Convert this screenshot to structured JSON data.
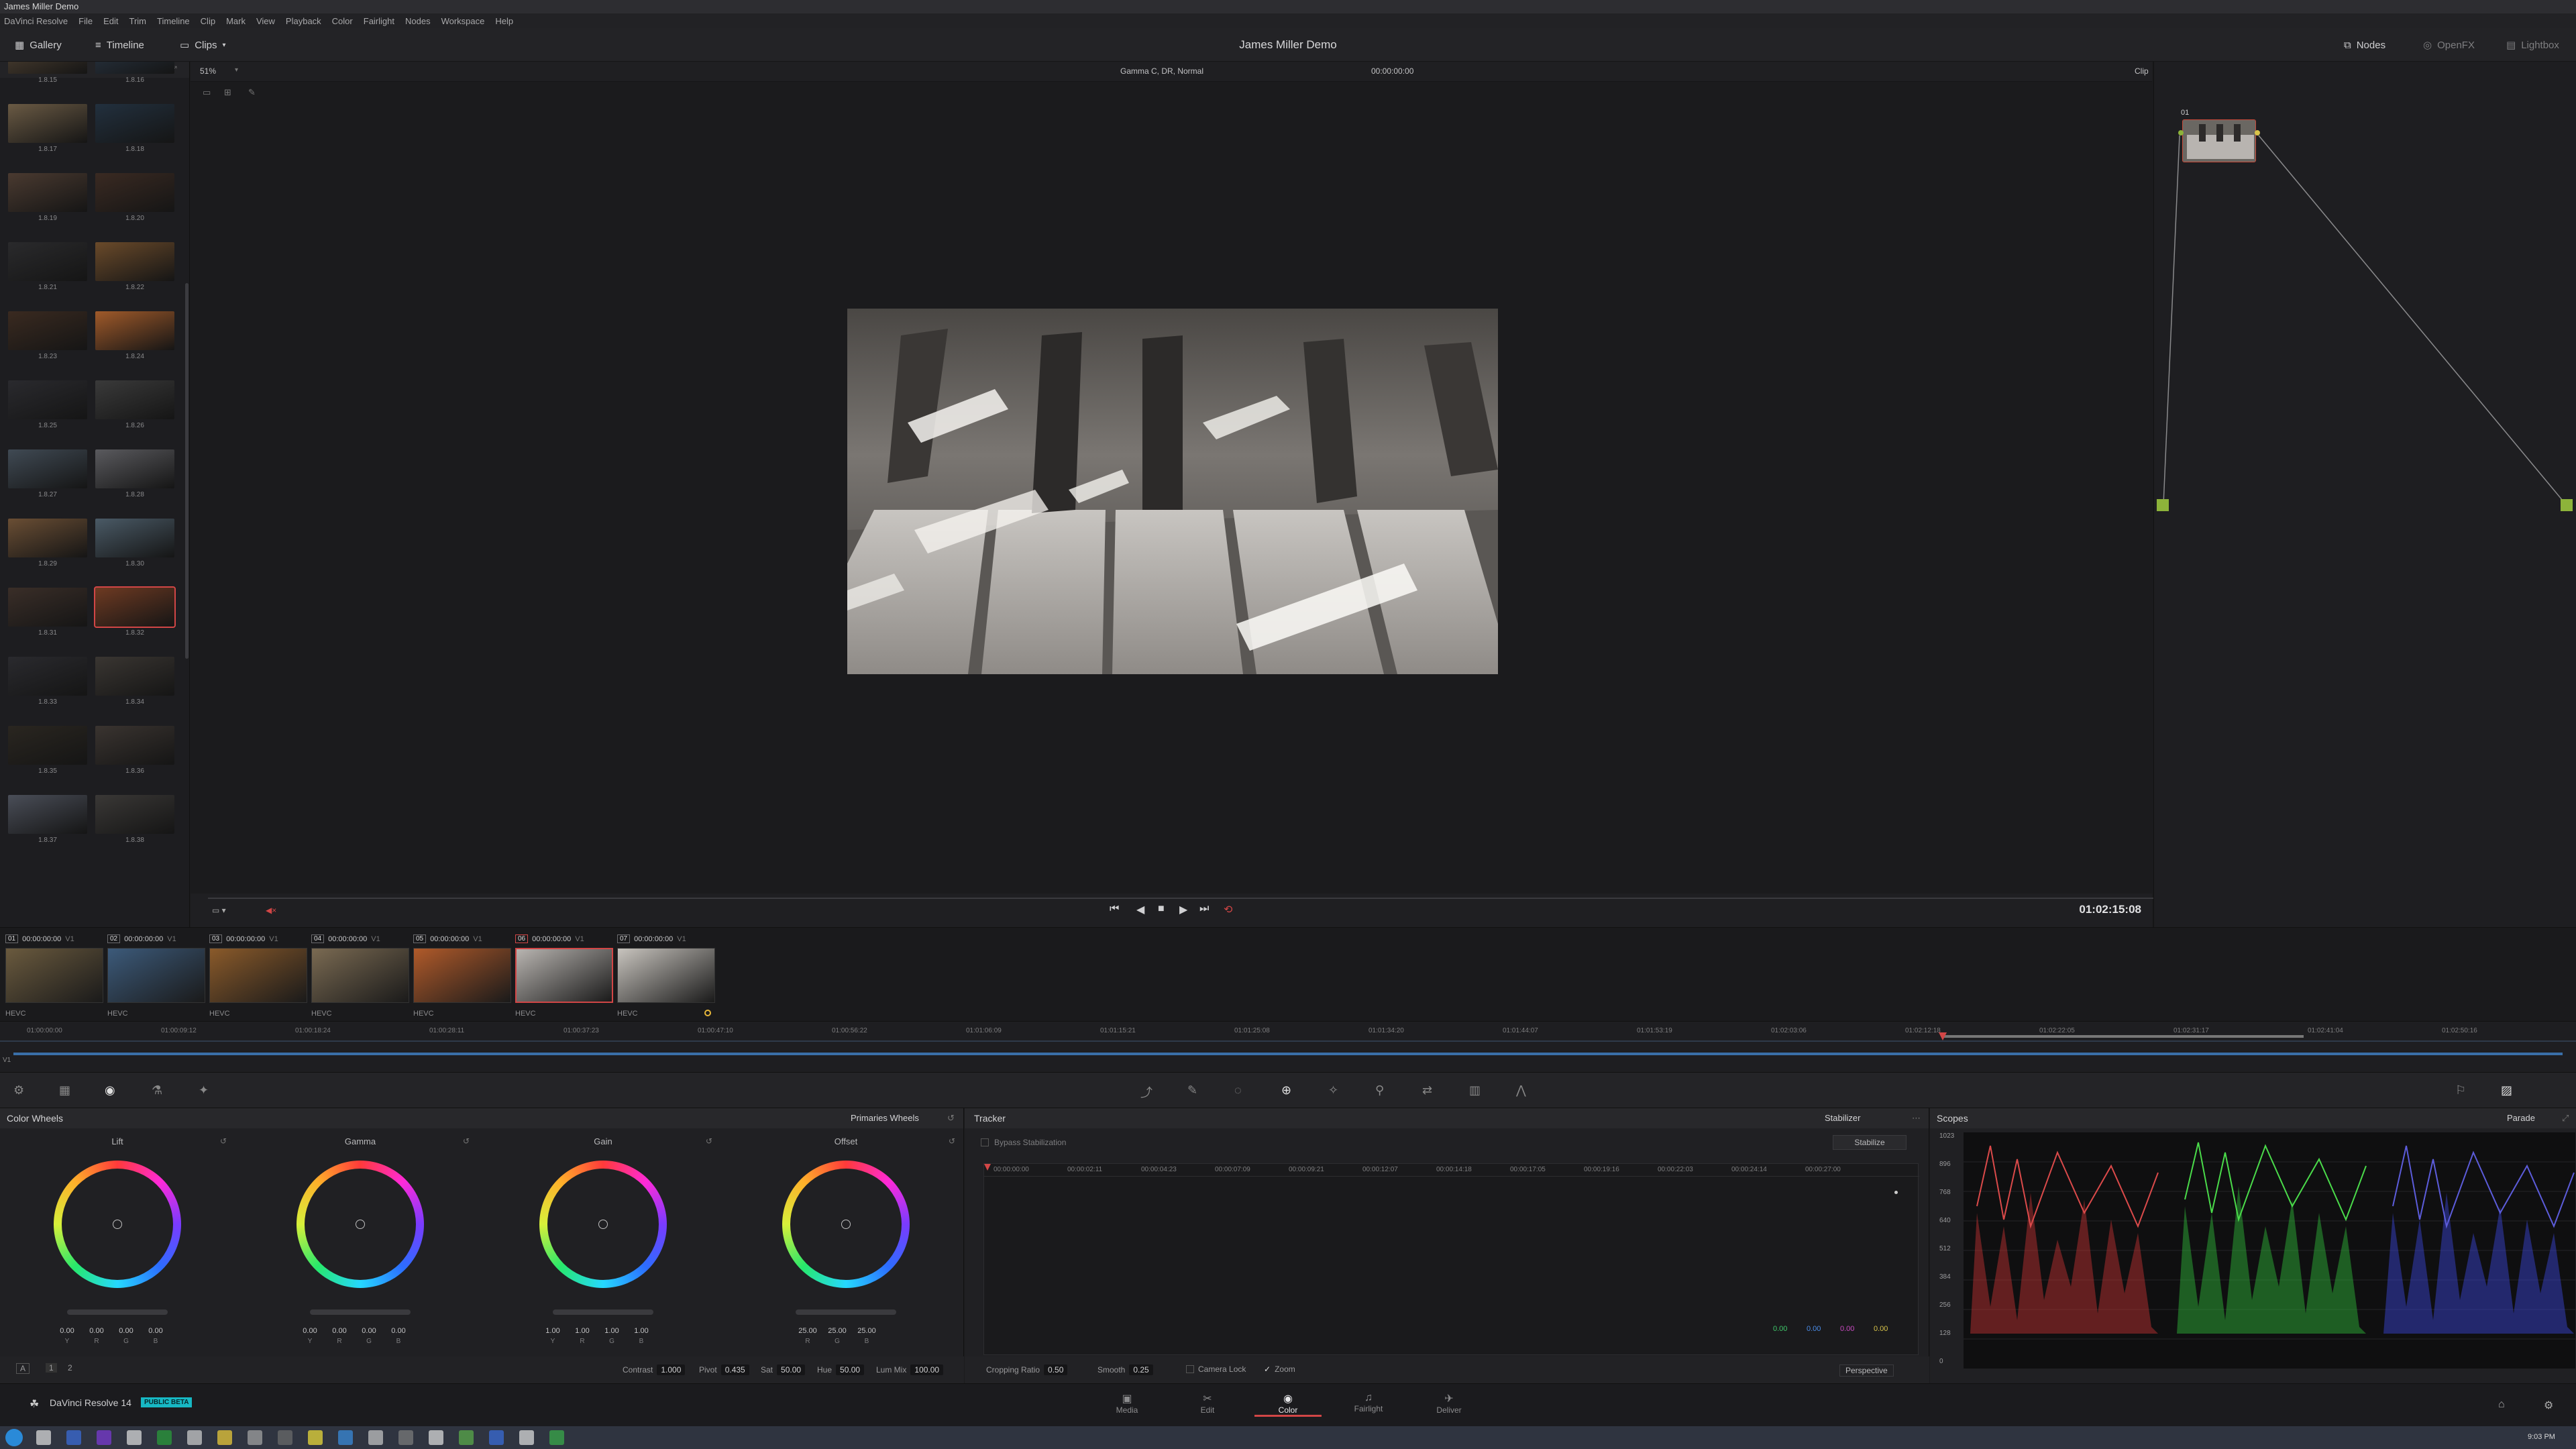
{
  "window": {
    "os_title": "James Miller Demo"
  },
  "menu": [
    "DaVinci Resolve",
    "File",
    "Edit",
    "Trim",
    "Timeline",
    "Clip",
    "Mark",
    "View",
    "Playback",
    "Color",
    "Fairlight",
    "Nodes",
    "Workspace",
    "Help"
  ],
  "toolbar": {
    "gallery_label": "Gallery",
    "timeline_label": "Timeline",
    "clips_label": "Clips",
    "project_title": "James Miller Demo",
    "nodes_label": "Nodes",
    "openfx_label": "OpenFX",
    "lightbox_label": "Lightbox"
  },
  "viewer": {
    "zoom": "51%",
    "gamma_label": "Gamma C, DR, Normal",
    "header_timecode": "00:00:00:00",
    "mode_label": "Clip",
    "timecode": "01:02:15:08"
  },
  "gallery": {
    "stills": [
      "1.8.15",
      "1.8.16",
      "1.8.17",
      "1.8.18",
      "1.8.19",
      "1.8.20",
      "1.8.21",
      "1.8.22",
      "1.8.23",
      "1.8.24",
      "1.8.25",
      "1.8.26",
      "1.8.27",
      "1.8.28",
      "1.8.29",
      "1.8.30",
      "1.8.31",
      "1.8.32",
      "1.8.33",
      "1.8.34",
      "1.8.35",
      "1.8.36",
      "1.8.37",
      "1.8.38"
    ]
  },
  "nodes": {
    "node_label": "01"
  },
  "clips": [
    {
      "num": "01",
      "tc": "00:00:00:00",
      "track": "V1",
      "codec": "HEVC"
    },
    {
      "num": "02",
      "tc": "00:00:00:00",
      "track": "V1",
      "codec": "HEVC"
    },
    {
      "num": "03",
      "tc": "00:00:00:00",
      "track": "V1",
      "codec": "HEVC"
    },
    {
      "num": "04",
      "tc": "00:00:00:00",
      "track": "V1",
      "codec": "HEVC"
    },
    {
      "num": "05",
      "tc": "00:00:00:00",
      "track": "V1",
      "codec": "HEVC"
    },
    {
      "num": "06",
      "tc": "00:00:00:00",
      "track": "V1",
      "codec": "HEVC"
    },
    {
      "num": "07",
      "tc": "00:00:00:00",
      "track": "V1",
      "codec": "HEVC"
    }
  ],
  "mini_timeline": {
    "ticks": [
      "01:00:00:00",
      "01:00:09:12",
      "01:00:18:24",
      "01:00:28:11",
      "01:00:37:23",
      "01:00:47:10",
      "01:00:56:22",
      "01:01:06:09",
      "01:01:15:21",
      "01:01:25:08",
      "01:01:34:20",
      "01:01:44:07",
      "01:01:53:19",
      "01:02:03:06",
      "01:02:12:18",
      "01:02:22:05",
      "01:02:31:17",
      "01:02:41:04",
      "01:02:50:16"
    ]
  },
  "color_wheels": {
    "title": "Color Wheels",
    "mode": "Primaries Wheels",
    "wheels": [
      {
        "name": "Lift",
        "values": [
          "0.00",
          "0.00",
          "0.00",
          "0.00"
        ]
      },
      {
        "name": "Gamma",
        "values": [
          "0.00",
          "0.00",
          "0.00",
          "0.00"
        ]
      },
      {
        "name": "Gain",
        "values": [
          "1.00",
          "1.00",
          "1.00",
          "1.00"
        ]
      },
      {
        "name": "Offset",
        "values": [
          "25.00",
          "25.00",
          "25.00"
        ]
      }
    ],
    "channels4": [
      "Y",
      "R",
      "G",
      "B"
    ],
    "channels3": [
      "R",
      "G",
      "B"
    ],
    "footer": {
      "contrast_label": "Contrast",
      "contrast": "1.000",
      "pivot_label": "Pivot",
      "pivot": "0.435",
      "sat_label": "Sat",
      "sat": "50.00",
      "hue_label": "Hue",
      "hue": "50.00",
      "lummix_label": "Lum Mix",
      "lummix": "100.00",
      "page_a": "A",
      "page_1": "1",
      "page_2": "2"
    }
  },
  "tracker": {
    "title": "Tracker",
    "mode": "Stabilizer",
    "bypass_label": "Bypass Stabilization",
    "stabilize_label": "Stabilize",
    "ticks": [
      "00:00:00:00",
      "00:00:02:11",
      "00:00:04:23",
      "00:00:07:09",
      "00:00:09:21",
      "00:00:12:07",
      "00:00:14:18",
      "00:00:17:05",
      "00:00:19:16",
      "00:00:22:03",
      "00:00:24:14",
      "00:00:27:00"
    ],
    "readouts": [
      "0.00",
      "0.00",
      "0.00",
      "0.00"
    ],
    "footer": {
      "cropping_label": "Cropping Ratio",
      "cropping": "0.50",
      "smooth_label": "Smooth",
      "smooth": "0.25",
      "camera_lock": "Camera Lock",
      "zoom": "Zoom",
      "perspective": "Perspective"
    }
  },
  "scopes": {
    "title": "Scopes",
    "mode": "Parade",
    "scale": [
      "1023",
      "896",
      "768",
      "640",
      "512",
      "384",
      "256",
      "128",
      "0"
    ]
  },
  "pages": [
    {
      "label": "Media",
      "icon": "media-icon"
    },
    {
      "label": "Edit",
      "icon": "edit-icon"
    },
    {
      "label": "Color",
      "icon": "color-icon"
    },
    {
      "label": "Fairlight",
      "icon": "fairlight-icon"
    },
    {
      "label": "Deliver",
      "icon": "deliver-icon"
    }
  ],
  "brand": {
    "name": "DaVinci Resolve 14",
    "badge": "PUBLIC BETA"
  },
  "taskbar": {
    "clock": "9:03 PM"
  },
  "colors": {
    "accent_red": "#d24646",
    "beta_badge": "#17b8c4",
    "node_green": "#8db33a"
  }
}
